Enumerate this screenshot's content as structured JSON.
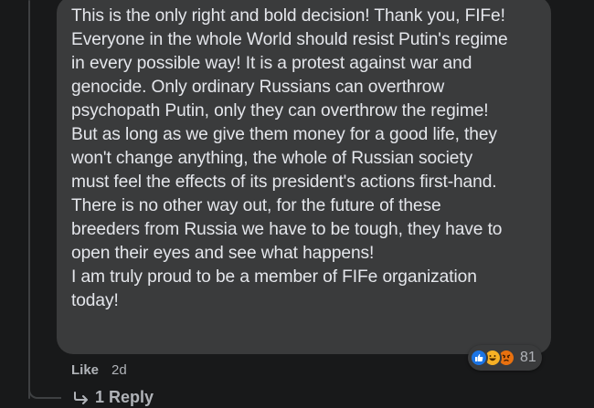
{
  "comment": {
    "text": "This is the only right and bold decision! Thank you, FIFe!\nEveryone in the whole World should resist Putin's regime\nin every possible way! It is a protest against war and\ngenocide. Only ordinary Russians can overthrow\npsychopath Putin, only they can overthrow the regime!\nBut as long as we give them money for a good life, they\nwon't change anything, the whole of Russian society\nmust feel the effects of its president's actions first-hand.\nThere is no other way out, for the future of these\nbreeders from Russia we have to be tough, they have to\nopen their eyes and see what happens!\nI am truly proud to be a member of FIFe organization\ntoday!"
  },
  "reactions": {
    "icons": [
      "like-icon",
      "haha-icon",
      "angry-icon"
    ],
    "count": "81"
  },
  "actions": {
    "like_label": "Like",
    "timestamp": "2d"
  },
  "replies": {
    "label": "1 Reply"
  },
  "colors": {
    "background": "#18191a",
    "bubble": "#3a3b3c",
    "text": "#e4e6eb",
    "secondary_text": "#b0b3b8",
    "like_blue": "#1b74e4"
  }
}
